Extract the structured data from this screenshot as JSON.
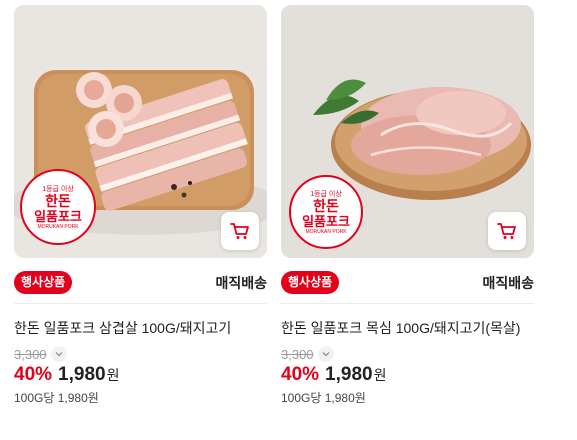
{
  "products": [
    {
      "image_alt": "pork belly",
      "badge_lines": [
        "1등급 이상",
        "한돈",
        "일품포크",
        "MORUKAN PORK"
      ],
      "event_label": "행사상품",
      "delivery": "매직배송",
      "title": "한돈 일품포크 삼겹살 100G/돼지고기",
      "original_price": "3,300",
      "discount": "40%",
      "price": "1,980",
      "currency": "원",
      "unit_price": "100G당 1,980원",
      "icons": {
        "cart": "cart-icon",
        "chevron": "chevron-down-icon"
      }
    },
    {
      "image_alt": "pork neck",
      "badge_lines": [
        "1등급 이상",
        "한돈",
        "일품포크",
        "MORUKAN PORK"
      ],
      "event_label": "행사상품",
      "delivery": "매직배송",
      "title": "한돈 일품포크 목심 100G/돼지고기(목살)",
      "original_price": "3,300",
      "discount": "40%",
      "price": "1,980",
      "currency": "원",
      "unit_price": "100G당 1,980원",
      "icons": {
        "cart": "cart-icon",
        "chevron": "chevron-down-icon"
      }
    }
  ],
  "colors": {
    "accent": "#e3001b",
    "text": "#222222",
    "muted": "#9a9a9a"
  }
}
